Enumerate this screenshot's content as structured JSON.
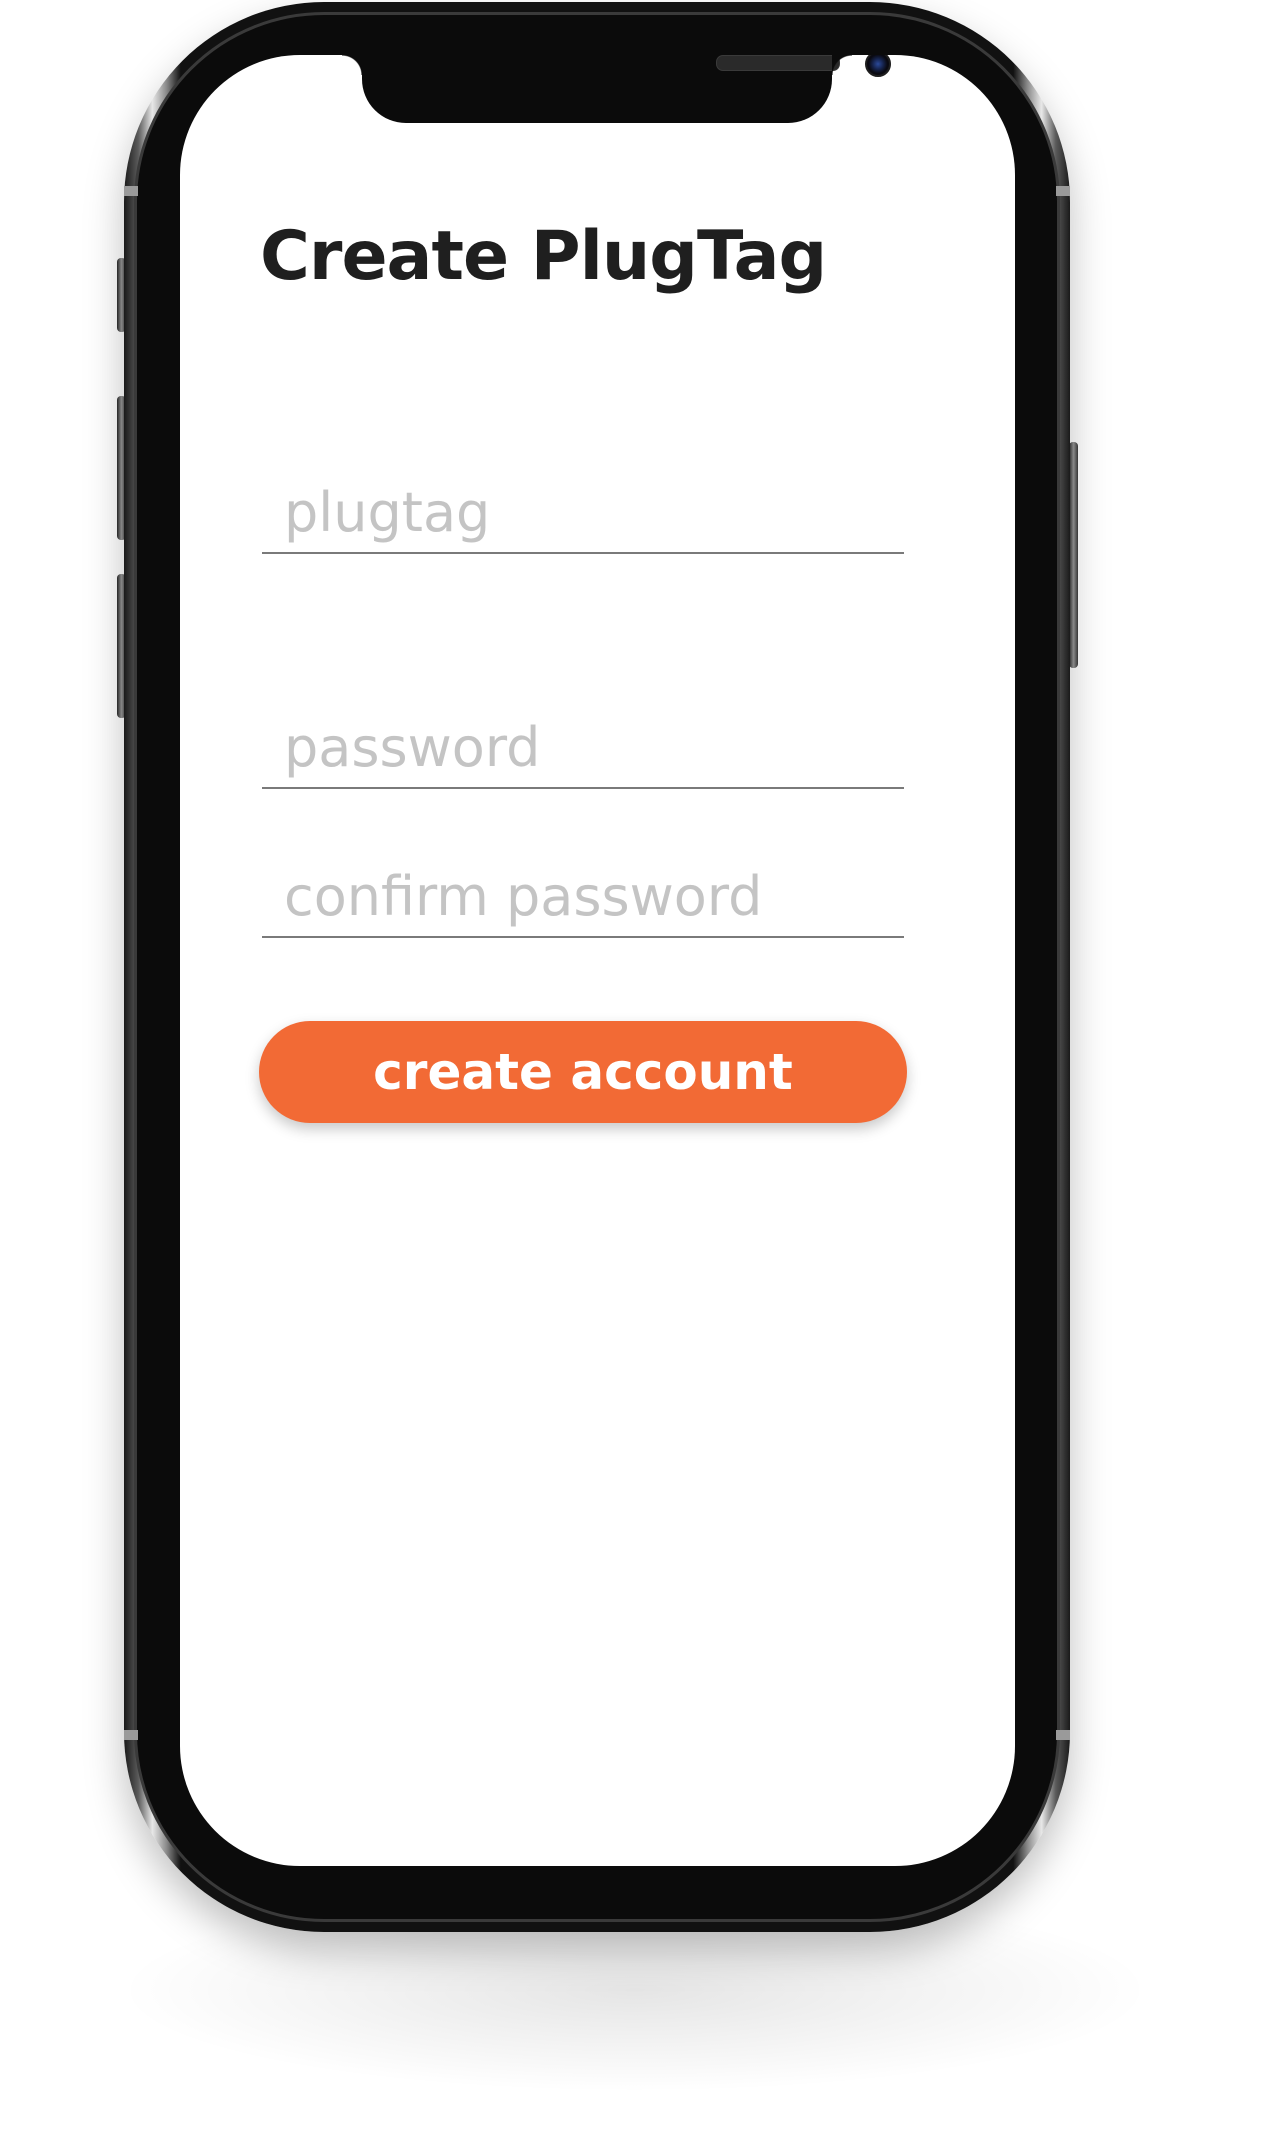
{
  "screen": {
    "title": "Create PlugTag",
    "fields": {
      "plugtag": {
        "value": "",
        "placeholder": "plugtag"
      },
      "password": {
        "value": "",
        "placeholder": "password"
      },
      "confirm_password": {
        "value": "",
        "placeholder": "confirm password"
      }
    },
    "create_button_label": "create account"
  },
  "colors": {
    "accent": "#f26a35",
    "title_text": "#1f1f1f",
    "placeholder_text": "#c4c4c4",
    "field_underline": "#7a7a7a",
    "device_frame": "#0b0b0b"
  }
}
